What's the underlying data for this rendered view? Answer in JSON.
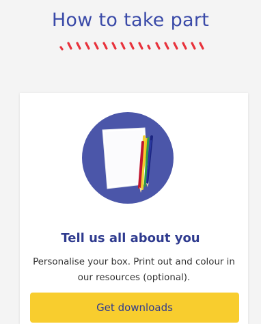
{
  "section": {
    "heading": "How to take part"
  },
  "card": {
    "title": "Tell us all about you",
    "description": "Personalise your box. Print out and colour in our resources (optional).",
    "button_label": "Get downloads"
  },
  "colors": {
    "heading": "#3a4aa8",
    "squiggle": "#e8323c",
    "circle": "#4b56a9",
    "button": "#f8cd2e"
  },
  "icons": {
    "squiggle": "red-dash-squiggle-decoration",
    "illustration": "paper-and-pencils-illustration"
  }
}
